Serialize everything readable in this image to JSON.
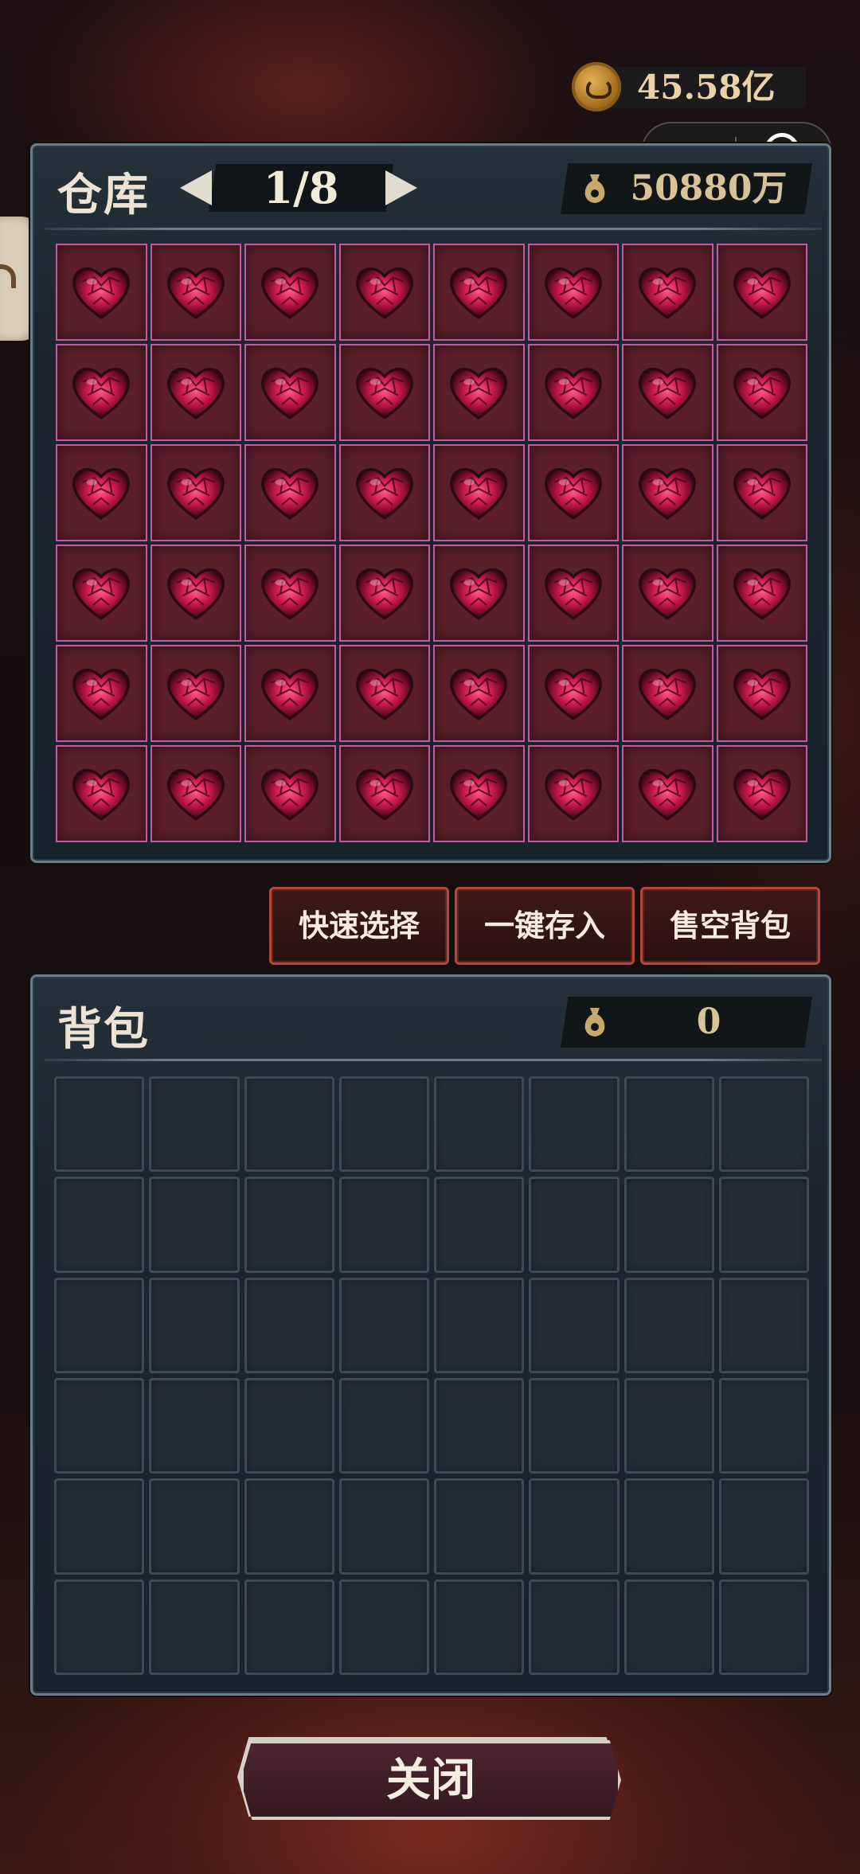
{
  "currency": {
    "coin_value": "45.58亿",
    "coin_icon": "gold-coin-icon"
  },
  "capsule": {
    "more_icon": "more-dots-icon",
    "close_icon": "target-circle-icon"
  },
  "warehouse": {
    "title": "仓库",
    "page": "1/8",
    "money": "50880万",
    "item_icon": "crystal-heart-icon",
    "rows": 6,
    "cols": 8,
    "filled_slots": 48
  },
  "actions": {
    "quick_select": "快速选择",
    "deposit_all": "一键存入",
    "sell_bag": "售空背包"
  },
  "bag": {
    "title": "背包",
    "money": "0",
    "rows": 6,
    "cols": 8,
    "filled_slots": 0
  },
  "close_label": "关闭",
  "colors": {
    "slot_filled_border": "#c45aa2",
    "button_border": "#b8473b",
    "panel_border": "#6d7c86"
  }
}
